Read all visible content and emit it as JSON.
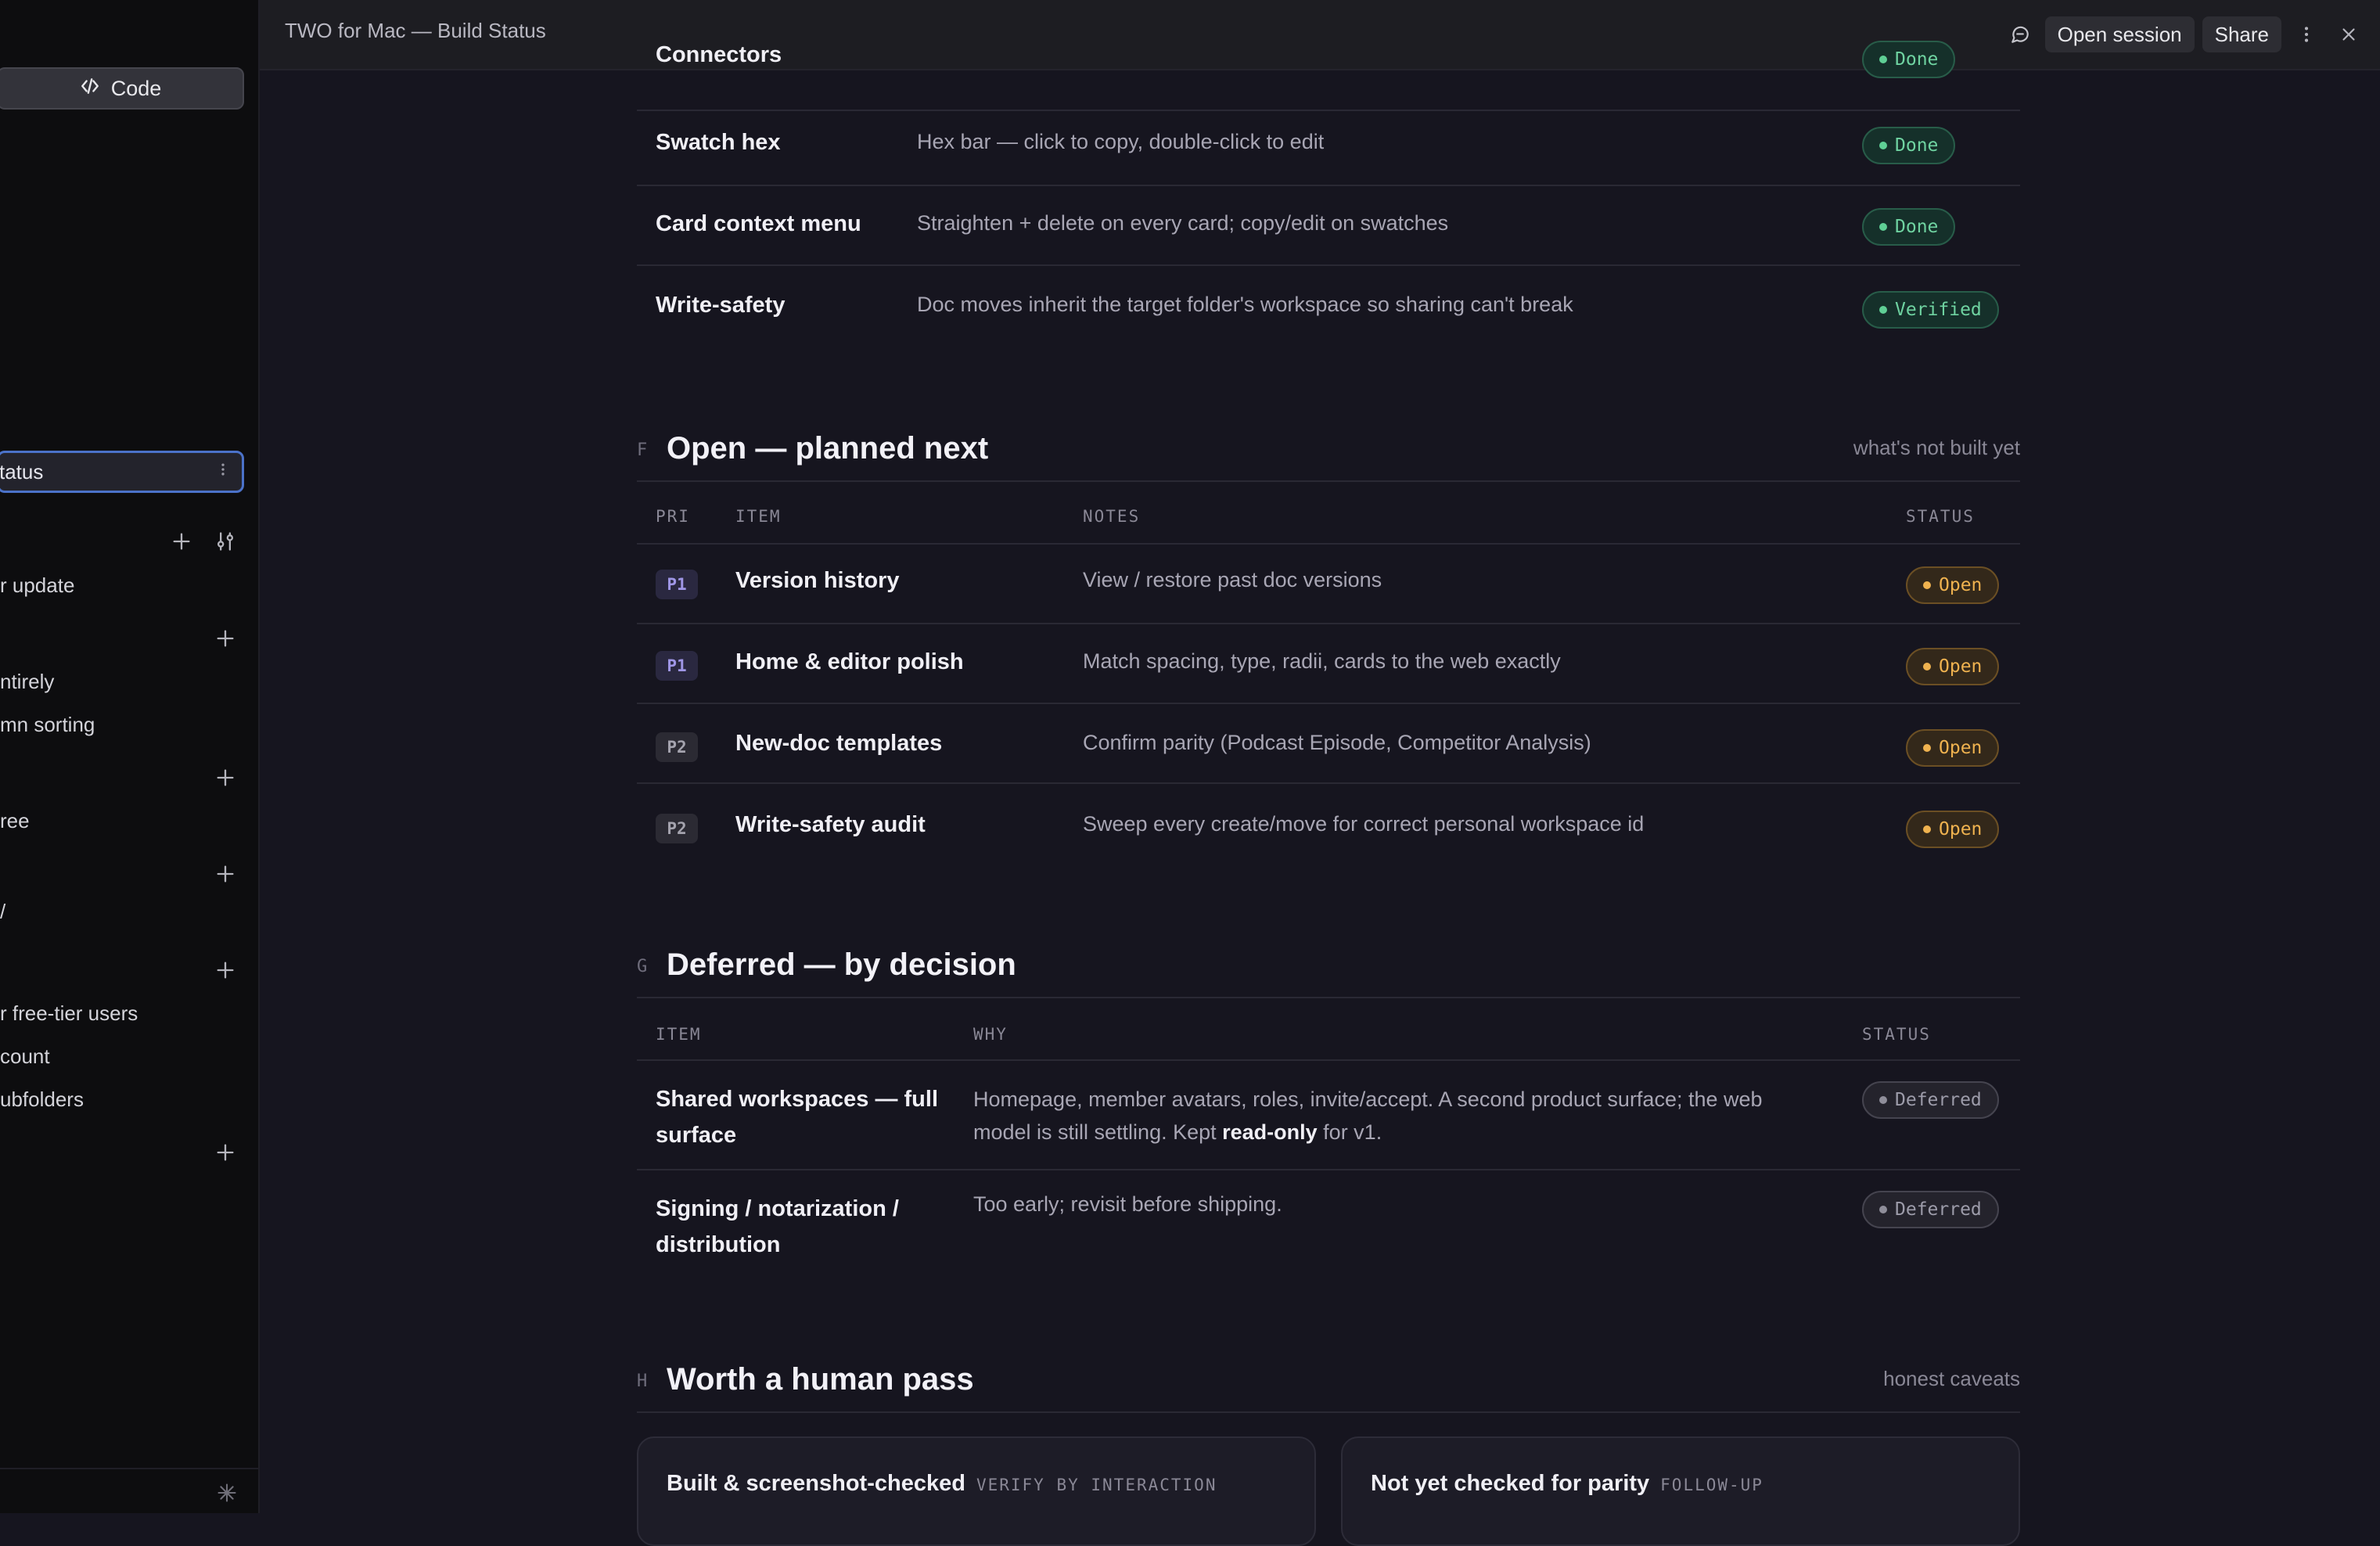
{
  "window": {
    "title": "TWO for Mac — Build Status",
    "open_session_label": "Open session",
    "share_label": "Share"
  },
  "sidebar": {
    "code_label": "Code",
    "active_doc": "tatus",
    "items": [
      "r update",
      "ntirely",
      "mn sorting",
      "ree",
      "/",
      "r free-tier users",
      "count",
      "ubfolders"
    ]
  },
  "done_rows": [
    {
      "name": "Connectors",
      "note": "",
      "status": "Done"
    },
    {
      "name": "Swatch hex",
      "note": "Hex bar — click to copy, double-click to edit",
      "status": "Done"
    },
    {
      "name": "Card context menu",
      "note": "Straighten + delete on every card; copy/edit on swatches",
      "status": "Done"
    },
    {
      "name": "Write-safety",
      "note": "Doc moves inherit the target folder's workspace so sharing can't break",
      "status": "Verified"
    }
  ],
  "section_f": {
    "letter": "F",
    "title": "Open — planned next",
    "aside": "what's not built yet",
    "headers": {
      "pri": "PRI",
      "item": "ITEM",
      "notes": "NOTES",
      "status": "STATUS"
    },
    "rows": [
      {
        "pri": "P1",
        "item": "Version history",
        "note": "View / restore past doc versions",
        "status": "Open"
      },
      {
        "pri": "P1",
        "item": "Home & editor polish",
        "note": "Match spacing, type, radii, cards to the web exactly",
        "status": "Open"
      },
      {
        "pri": "P2",
        "item": "New-doc templates",
        "note": "Confirm parity (Podcast Episode, Competitor Analysis)",
        "status": "Open"
      },
      {
        "pri": "P2",
        "item": "Write-safety audit",
        "note": "Sweep every create/move for correct personal workspace id",
        "status": "Open"
      }
    ]
  },
  "section_g": {
    "letter": "G",
    "title": "Deferred — by decision",
    "headers": {
      "item": "ITEM",
      "why": "WHY",
      "status": "STATUS"
    },
    "rows": [
      {
        "item_line1": "Shared workspaces — full",
        "item_line2": "surface",
        "why_line1": "Homepage, member avatars, roles, invite/accept. A second product surface; the web",
        "why_line2_pre": "model is still settling. Kept ",
        "why_line2_bold": "read-only",
        "why_line2_post": " for v1.",
        "status": "Deferred"
      },
      {
        "item_line1": "Signing / notarization /",
        "item_line2": "distribution",
        "why_line1": "Too early; revisit before shipping.",
        "status": "Deferred"
      }
    ]
  },
  "section_h": {
    "letter": "H",
    "title": "Worth a human pass",
    "aside": "honest caveats",
    "cards": [
      {
        "title": "Built & screenshot-checked",
        "tag": "VERIFY BY INTERACTION"
      },
      {
        "title": "Not yet checked for parity",
        "tag": "FOLLOW-UP"
      }
    ]
  }
}
